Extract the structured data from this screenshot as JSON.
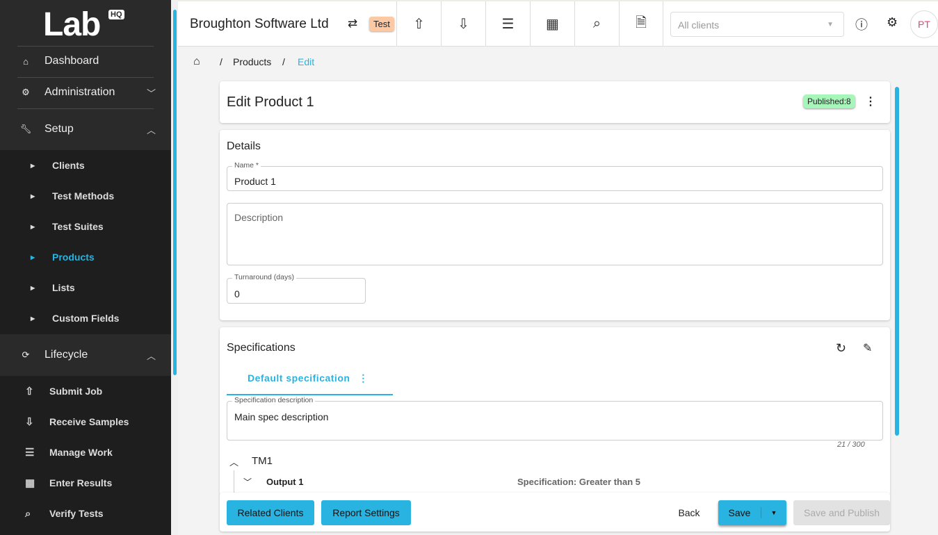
{
  "sidebar": {
    "logo": "Lab",
    "logo_badge": "HQ",
    "top": [
      {
        "label": "Dashboard",
        "icon": "home-icon"
      },
      {
        "label": "Administration",
        "icon": "gear-icon"
      },
      {
        "label": "Setup",
        "icon": "wrench-icon"
      }
    ],
    "setup_items": [
      {
        "label": "Clients"
      },
      {
        "label": "Test Methods"
      },
      {
        "label": "Test Suites"
      },
      {
        "label": "Products",
        "active": true
      },
      {
        "label": "Lists"
      },
      {
        "label": "Custom Fields"
      }
    ],
    "lifecycle": {
      "label": "Lifecycle",
      "items": [
        {
          "label": "Submit Job"
        },
        {
          "label": "Receive Samples"
        },
        {
          "label": "Manage Work"
        },
        {
          "label": "Enter Results"
        },
        {
          "label": "Verify Tests"
        }
      ]
    }
  },
  "header": {
    "company": "Broughton Software Ltd",
    "env_badge": "Test",
    "client_select": {
      "placeholder": "All clients"
    },
    "avatar": "PT"
  },
  "breadcrumb": {
    "items": [
      "Products",
      "Edit"
    ]
  },
  "product": {
    "title": "Edit Product 1",
    "status_badge": "Published:8"
  },
  "details": {
    "heading": "Details",
    "name_label": "Name *",
    "name_value": "Product 1",
    "description_placeholder": "Description",
    "turnaround_label": "Turnaround (days)",
    "turnaround_value": "0"
  },
  "specifications": {
    "heading": "Specifications",
    "tab": "Default specification",
    "desc_label": "Specification description",
    "desc_value": "Main spec description",
    "counter": "21 / 300",
    "test_method": "TM1",
    "output": "Output 1",
    "output_spec": "Specification: Greater than 5"
  },
  "footer": {
    "related_clients": "Related Clients",
    "report_settings": "Report Settings",
    "back": "Back",
    "save": "Save",
    "save_publish": "Save and Publish"
  },
  "colors": {
    "accent": "#29b3e0",
    "sidebar": "#2a2a2a",
    "published": "#a6f5b9",
    "env": "#fcc9a5"
  }
}
